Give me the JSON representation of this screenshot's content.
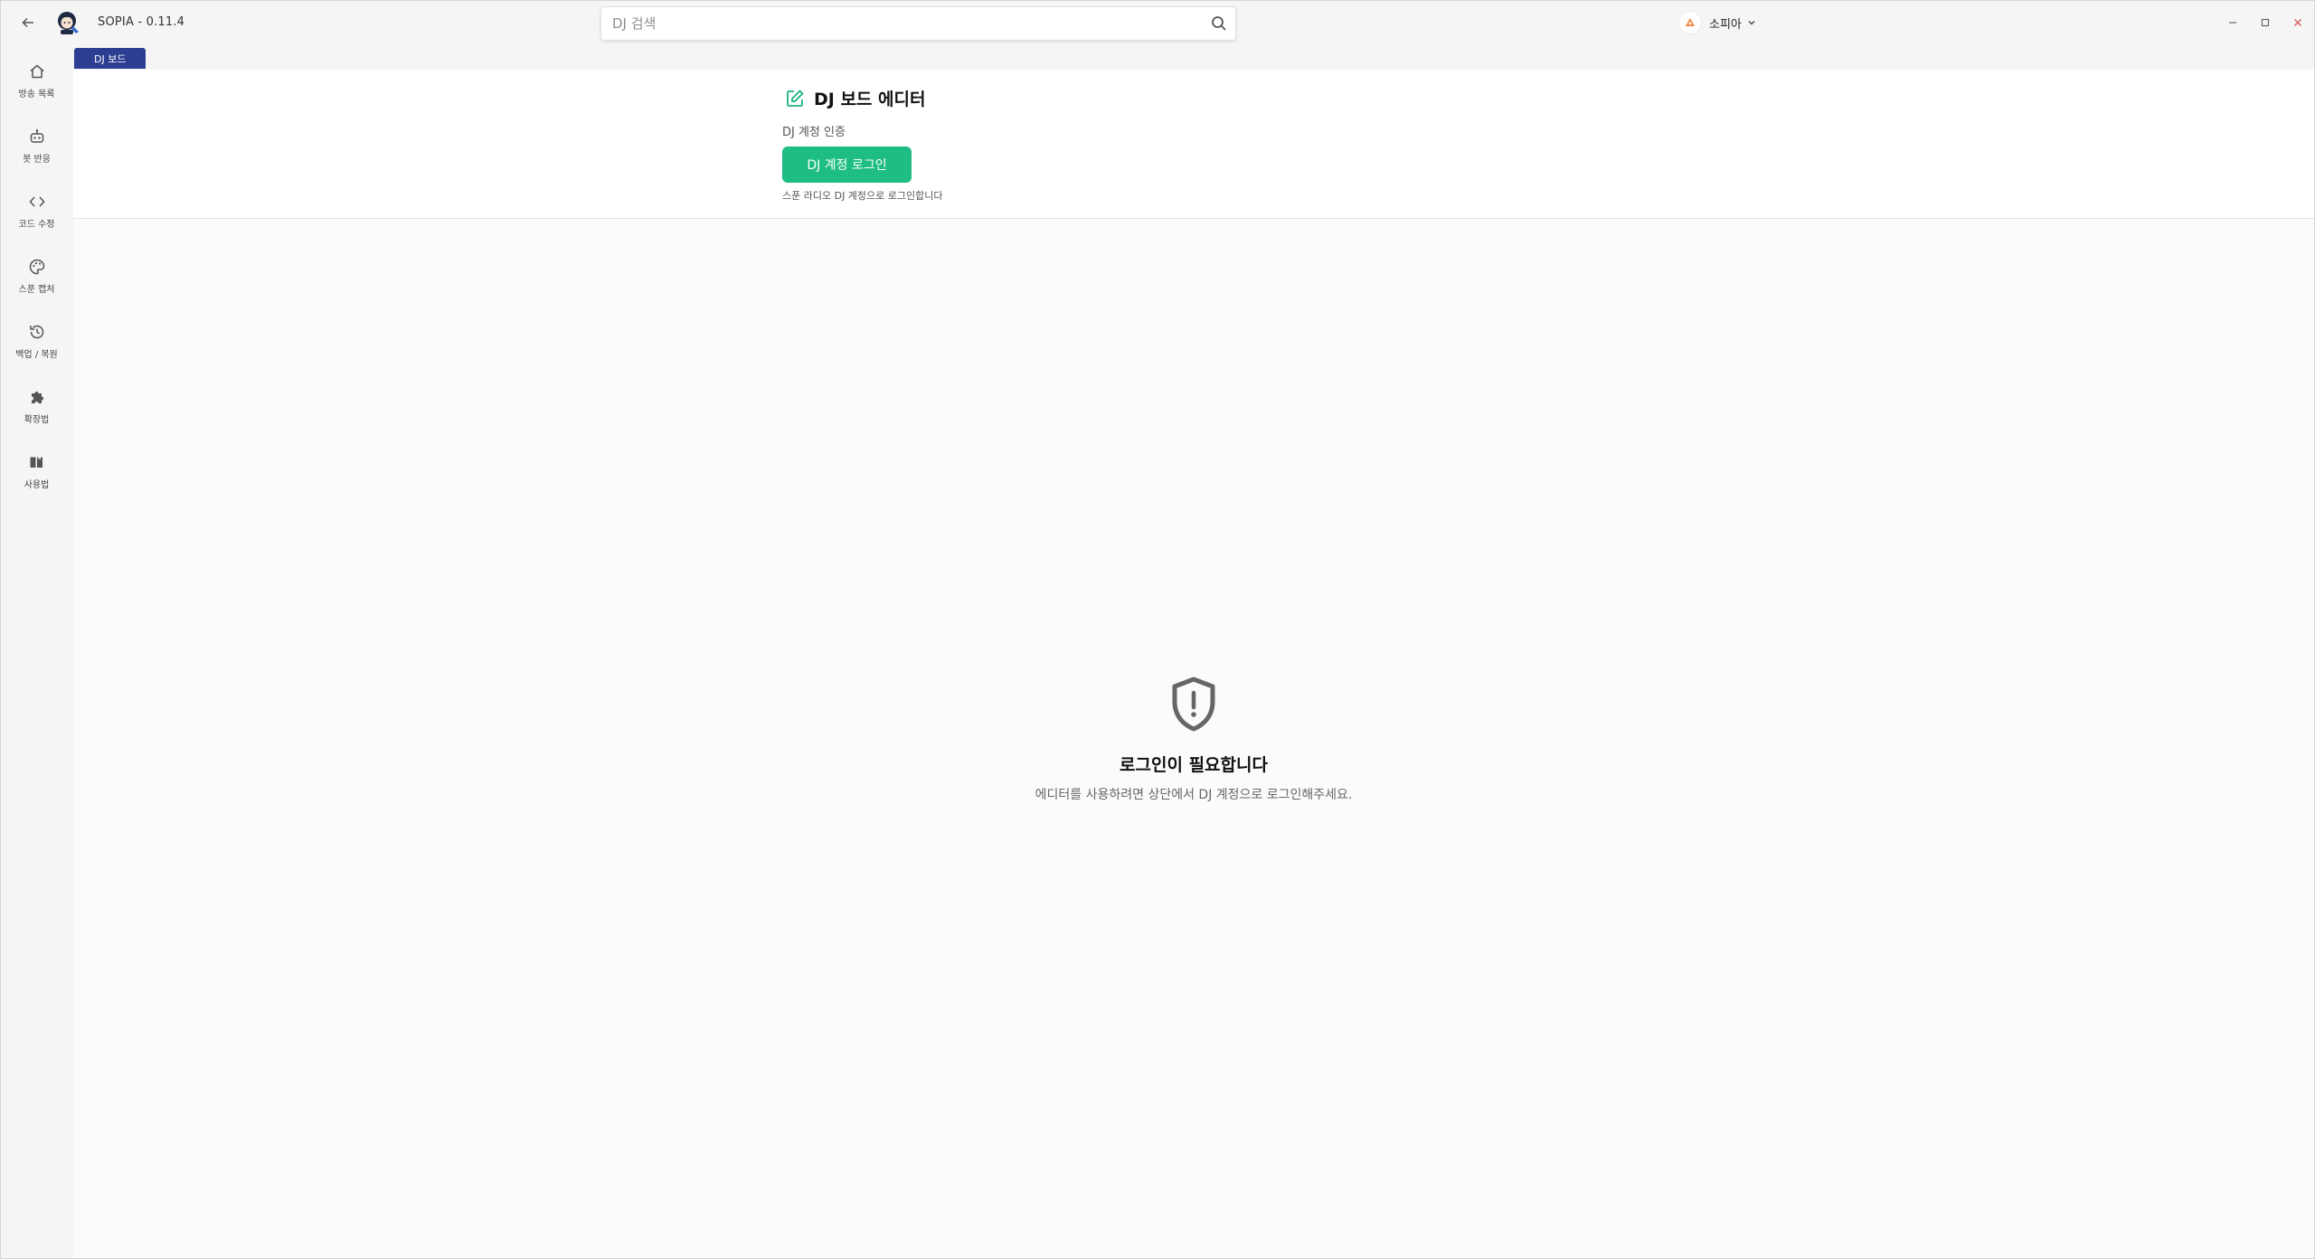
{
  "app": {
    "title": "SOPIA - 0.11.4"
  },
  "search": {
    "placeholder": "DJ 검색",
    "value": ""
  },
  "user": {
    "name": "소피아"
  },
  "sidebar": {
    "items": [
      {
        "label": "방송 목록",
        "icon": "home-icon"
      },
      {
        "label": "봇 반응",
        "icon": "robot-icon"
      },
      {
        "label": "코드 수정",
        "icon": "code-icon"
      },
      {
        "label": "스푼 캡처",
        "icon": "palette-icon"
      },
      {
        "label": "백업 / 복원",
        "icon": "history-icon"
      },
      {
        "label": "확장법",
        "icon": "puzzle-icon"
      },
      {
        "label": "사용법",
        "icon": "book-icon"
      }
    ]
  },
  "tab": {
    "label": "DJ 보드"
  },
  "editor": {
    "title": "DJ 보드 에디터",
    "auth_label": "DJ 계정 인증",
    "login_button": "DJ 계정 로그인",
    "login_hint": "스푼 라디오 DJ 계정으로 로그인합니다"
  },
  "empty": {
    "title": "로그인이 필요합니다",
    "description": "에디터를 사용하려면 상단에서 DJ 계정으로 로그인해주세요."
  },
  "colors": {
    "accent_green": "#1dbd83",
    "tab_blue": "#2c3e91",
    "close_red": "#d9534f"
  }
}
